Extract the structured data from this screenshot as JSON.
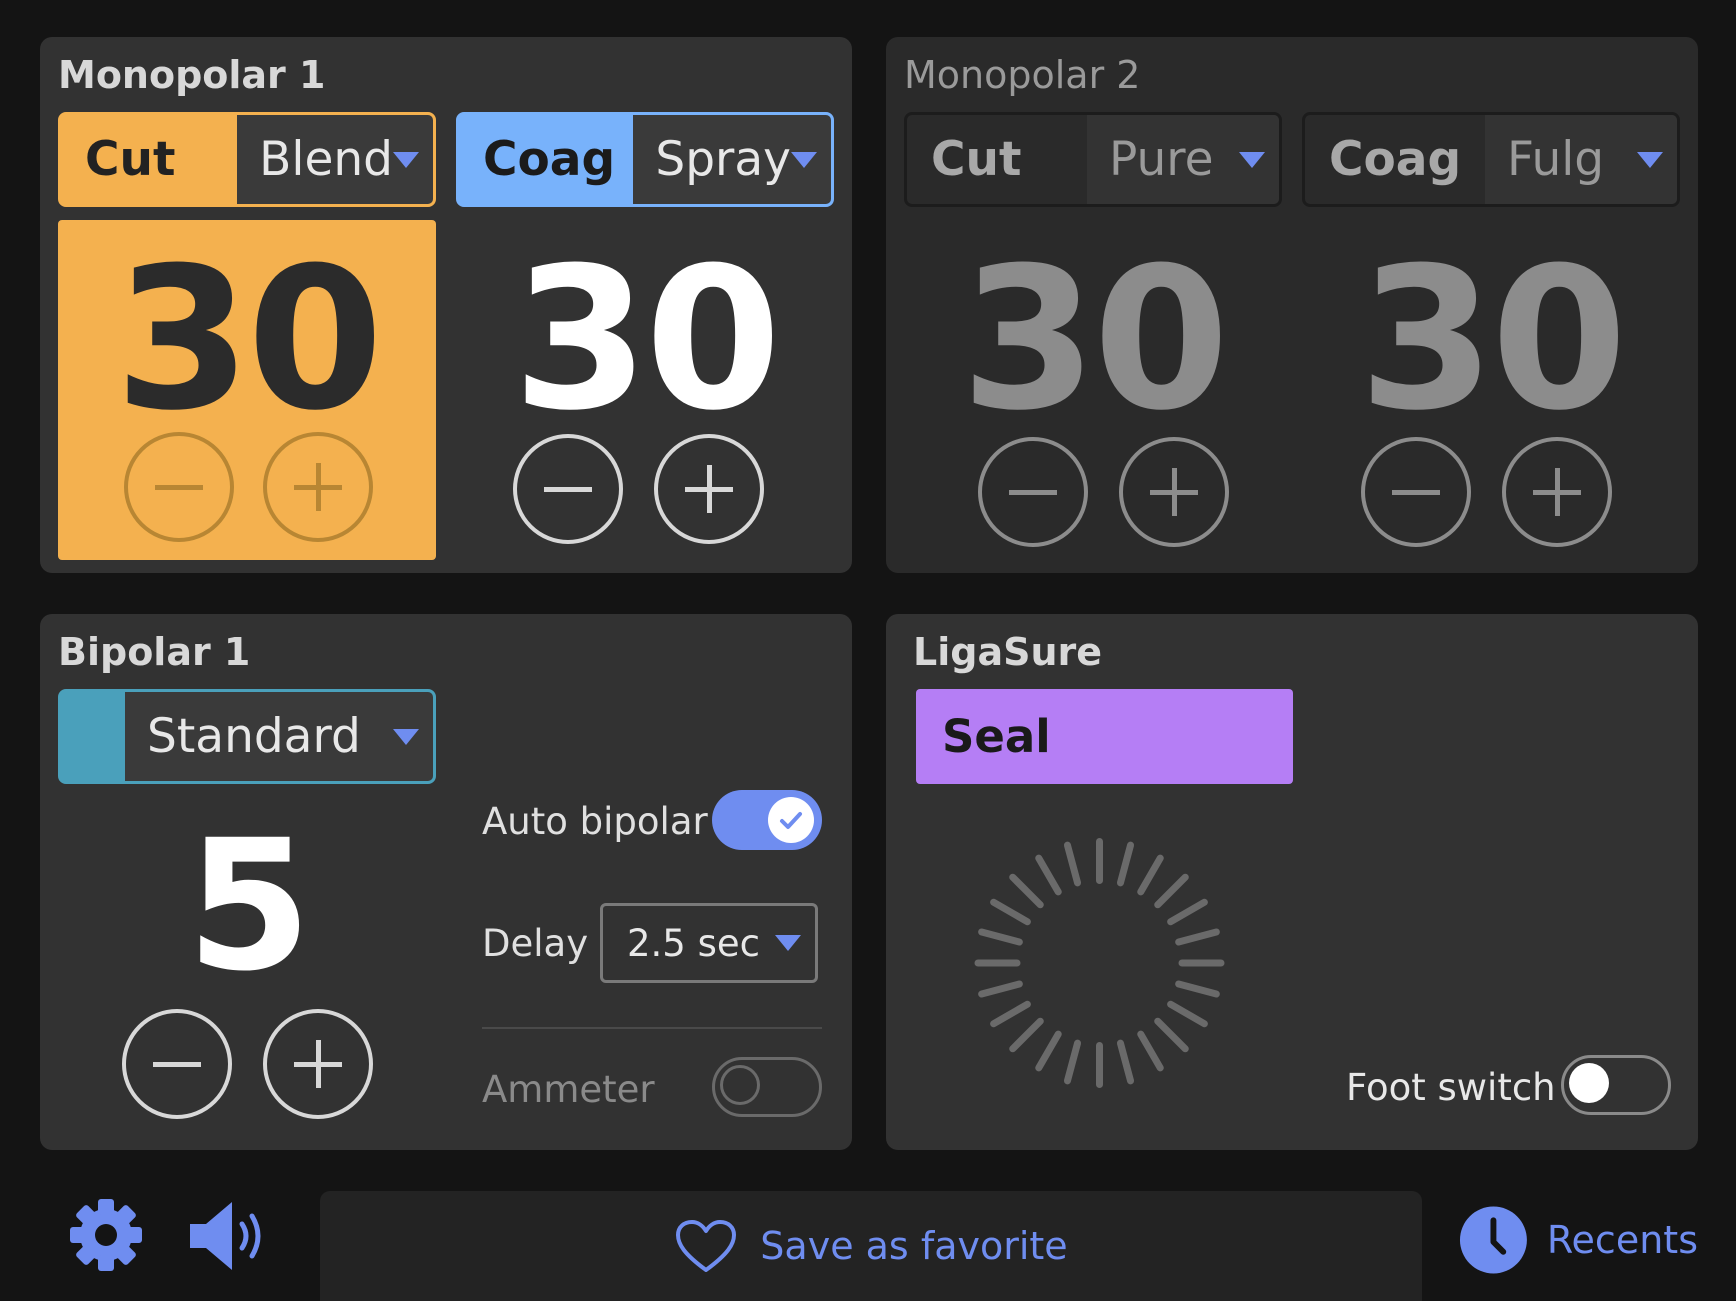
{
  "colors": {
    "cut_active": "#f4b14f",
    "coag_active": "#78b2fb",
    "bipolar_accent": "#4aa0bb",
    "ligasure_accent": "#b57ef5",
    "accent_blue": "#6f8df0"
  },
  "monopolar1": {
    "title": "Monopolar 1",
    "cut": {
      "label": "Cut",
      "mode": "Blend",
      "value": "30",
      "selected": true
    },
    "coag": {
      "label": "Coag",
      "mode": "Spray",
      "value": "30",
      "selected": true
    }
  },
  "monopolar2": {
    "title": "Monopolar 2",
    "cut": {
      "label": "Cut",
      "mode": "Pure",
      "value": "30"
    },
    "coag": {
      "label": "Coag",
      "mode": "Fulg",
      "value": "30"
    }
  },
  "bipolar1": {
    "title": "Bipolar 1",
    "mode": "Standard",
    "value": "5",
    "auto_bipolar_label": "Auto bipolar",
    "auto_bipolar_on": true,
    "delay_label": "Delay",
    "delay_value": "2.5 sec",
    "ammeter_label": "Ammeter",
    "ammeter_on": false
  },
  "ligasure": {
    "title": "LigaSure",
    "mode": "Seal",
    "foot_switch_label": "Foot switch",
    "foot_switch_on": false
  },
  "bottom_bar": {
    "settings_icon": "gear-icon",
    "volume_icon": "speaker-icon",
    "favorite_icon": "heart-icon",
    "favorite_label": "Save as favorite",
    "recents_icon": "clock-icon",
    "recents_label": "Recents"
  }
}
